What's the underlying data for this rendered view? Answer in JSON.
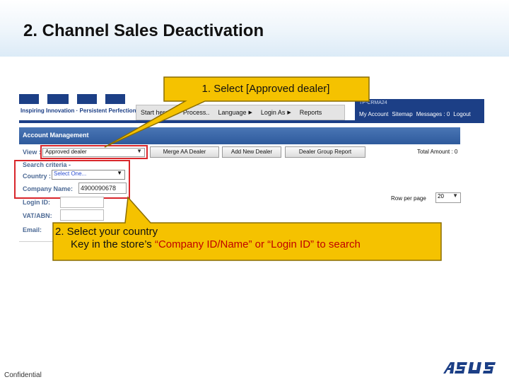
{
  "slide": {
    "title": "2. Channel Sales Deactivation",
    "footer": "Confidential"
  },
  "logo": {
    "brand": "ASUS",
    "tagline": "Inspiring Innovation · Persistent Perfection"
  },
  "top_nav": {
    "items": [
      {
        "label": "Start here",
        "arrow": false
      },
      {
        "label": "Process..",
        "arrow": true
      },
      {
        "label": "Language",
        "arrow": true
      },
      {
        "label": "Login As",
        "arrow": true
      },
      {
        "label": "Reports",
        "arrow": false
      }
    ]
  },
  "header_right": {
    "server": "TP-CRMA24",
    "links": [
      "My Account",
      "Sitemap",
      "Messages : 0",
      "Logout"
    ]
  },
  "account_management": {
    "title": "Account Management",
    "view_label": "View :",
    "view_value": "Approved dealer",
    "buttons": [
      "Merge AA Dealer",
      "Add New Dealer",
      "Dealer Group Report"
    ],
    "total_amount": "Total Amount : 0",
    "search_criteria_label": "Search criteria -",
    "country_label": "Country :",
    "country_value": "Select One...",
    "company_label": "Company Name:",
    "company_value": "4900090678",
    "login_label": "Login ID:",
    "vat_label": "VAT/ABN:",
    "email_label": "Email:",
    "row_per_page_label": "Row per page",
    "row_per_page_value": "20"
  },
  "callouts": {
    "step1": "1. Select [Approved dealer]",
    "step2_line1": "2. Select your country",
    "step2_line2_prefix": "Key in the store’s ",
    "step2_line2_red": "“Company ID/Name” or “Login ID” to search"
  },
  "colors": {
    "brand_blue": "#1c3f86",
    "callout_fill": "#f5c200",
    "callout_border": "#8a6d00",
    "highlight": "#d9262b"
  }
}
